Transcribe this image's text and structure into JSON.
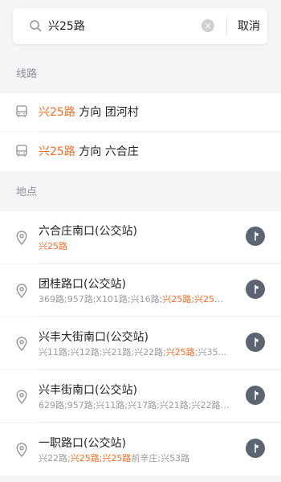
{
  "search": {
    "value": "兴25路",
    "cancel_label": "取消"
  },
  "sections": {
    "routes_title": "线路",
    "places_title": "地点"
  },
  "routes": [
    {
      "route": "兴25路",
      "text": " 方向 团河村"
    },
    {
      "route": "兴25路",
      "text": " 方向 六合庄"
    }
  ],
  "places": [
    {
      "name": "六合庄南口(公交站)",
      "routes_plain_before": "",
      "routes_highlight": "兴25路",
      "routes_plain_after": ""
    },
    {
      "name": "团桂路口(公交站)",
      "routes_plain_before": "369路;957路;X101路;兴16路;",
      "routes_highlight": "兴25路;兴25路...",
      "routes_plain_after": ""
    },
    {
      "name": "兴丰大街南口(公交站)",
      "routes_plain_before": "兴11路;兴12路;兴21路;兴22路;",
      "routes_highlight": "兴25路",
      "routes_plain_after": ";兴35..."
    },
    {
      "name": "兴丰街南口(公交站)",
      "routes_plain_before": "629路;957路;兴11路;兴17路;兴21路;兴22路;",
      "routes_highlight": "...",
      "routes_plain_after": ""
    },
    {
      "name": "一职路口(公交站)",
      "routes_plain_before": "兴22路;",
      "routes_highlight": "兴25路;兴25路",
      "routes_plain_after": "前辛庄;兴53路"
    }
  ],
  "colors": {
    "accent": "#ff6a22",
    "nav_button": "#5b6470",
    "section_bg": "#f4f5f7"
  },
  "icons": {
    "search": "search-icon",
    "clear": "clear-icon",
    "bus": "bus-icon",
    "pin": "location-pin-icon",
    "navigate": "navigate-icon"
  }
}
